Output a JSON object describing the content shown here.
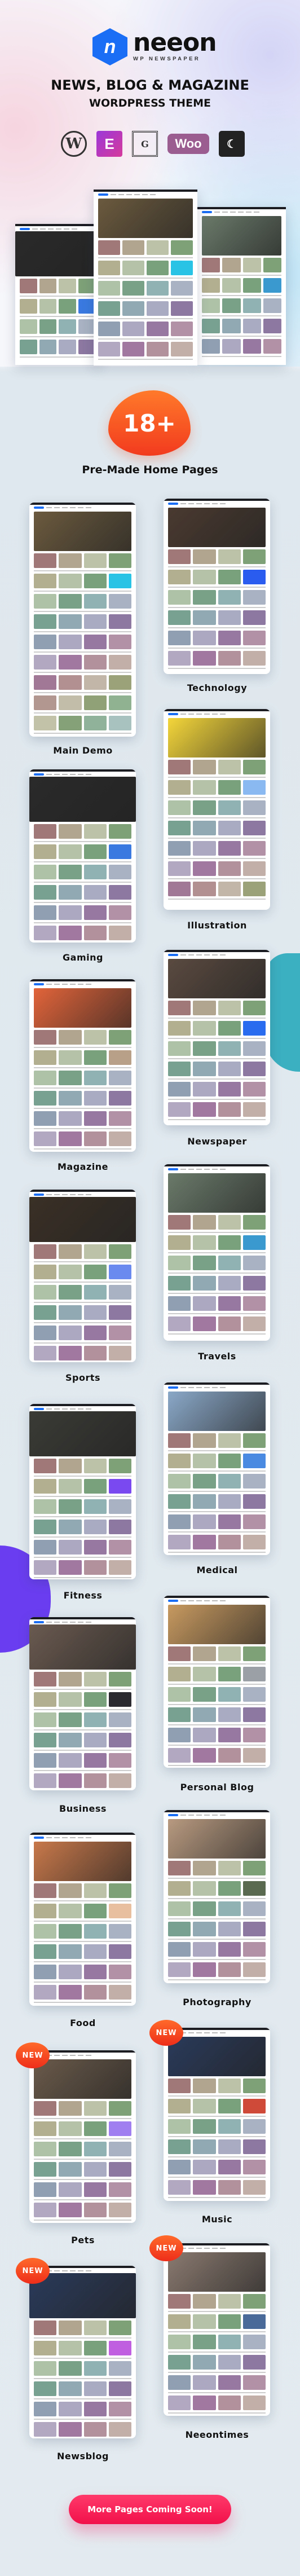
{
  "brand": {
    "name": "neeon",
    "tagline": "WP NEWSPAPER",
    "logo_letter": "n",
    "color": "#1a6ef5"
  },
  "headline": {
    "line1": "NEWS, BLOG & MAGAZINE",
    "line2": "WORDPRESS THEME"
  },
  "compat_icons": [
    {
      "name": "wordpress-icon",
      "glyph": "W"
    },
    {
      "name": "elementor-icon",
      "glyph": "E"
    },
    {
      "name": "gutenberg-icon",
      "glyph": "G"
    },
    {
      "name": "woocommerce-icon",
      "glyph": "Woo"
    },
    {
      "name": "dark-mode-icon",
      "glyph": "☾"
    }
  ],
  "count_badge": "18+",
  "section_title": "Pre-Made Home Pages",
  "new_badge": "NEW",
  "pages": [
    {
      "label": "Main Demo",
      "hero": "#6b5a3e",
      "accent": "#29c3e6",
      "dark": false,
      "new": false
    },
    {
      "label": "Technology",
      "hero": "#4a3a30",
      "accent": "#2a5cf0",
      "dark": false,
      "new": false
    },
    {
      "label": "Gaming",
      "hero": "#2a2a2a",
      "accent": "#3a7ae0",
      "dark": true,
      "new": false
    },
    {
      "label": "Illustration",
      "hero": "#f4d63a",
      "accent": "#8ab8f0",
      "dark": false,
      "new": false
    },
    {
      "label": "Magazine",
      "hero": "#e2643a",
      "accent": "#b8a088",
      "dark": false,
      "new": false
    },
    {
      "label": "Newspaper",
      "hero": "#5a4a40",
      "accent": "#2a6cf0",
      "dark": false,
      "new": false
    },
    {
      "label": "Sports",
      "hero": "#3a3026",
      "accent": "#6a8af0",
      "dark": true,
      "new": false
    },
    {
      "label": "Travels",
      "hero": "#6a7a6a",
      "accent": "#3a9ad0",
      "dark": false,
      "new": false
    },
    {
      "label": "Fitness",
      "hero": "#3a3a36",
      "accent": "#7a4af0",
      "dark": true,
      "new": false
    },
    {
      "label": "Medical",
      "hero": "#8aa8c8",
      "accent": "#4a8ae0",
      "dark": false,
      "new": false
    },
    {
      "label": "Business",
      "hero": "#6a5a50",
      "accent": "#2a2a30",
      "dark": true,
      "new": false
    },
    {
      "label": "Personal Blog",
      "hero": "#c89a60",
      "accent": "#9aa0a6",
      "dark": false,
      "new": false
    },
    {
      "label": "Food",
      "hero": "#c8784a",
      "accent": "#e8c0a0",
      "dark": false,
      "new": false
    },
    {
      "label": "Photography",
      "hero": "#b89a80",
      "accent": "#5a6a50",
      "dark": false,
      "new": false
    },
    {
      "label": "Pets",
      "hero": "#6a5a4a",
      "accent": "#a080f0",
      "dark": false,
      "new": true
    },
    {
      "label": "Music",
      "hero": "#2a3a5a",
      "accent": "#d04a3a",
      "dark": false,
      "new": true
    },
    {
      "label": "Newsblog",
      "hero": "#2a3a5a",
      "accent": "#c060e0",
      "dark": true,
      "new": true
    },
    {
      "label": "Neeontimes",
      "hero": "#8a7a70",
      "accent": "#4a6a9a",
      "dark": false,
      "new": true
    }
  ],
  "cta": {
    "label": "More Pages Coming Soon!",
    "color": "#f2104a"
  }
}
